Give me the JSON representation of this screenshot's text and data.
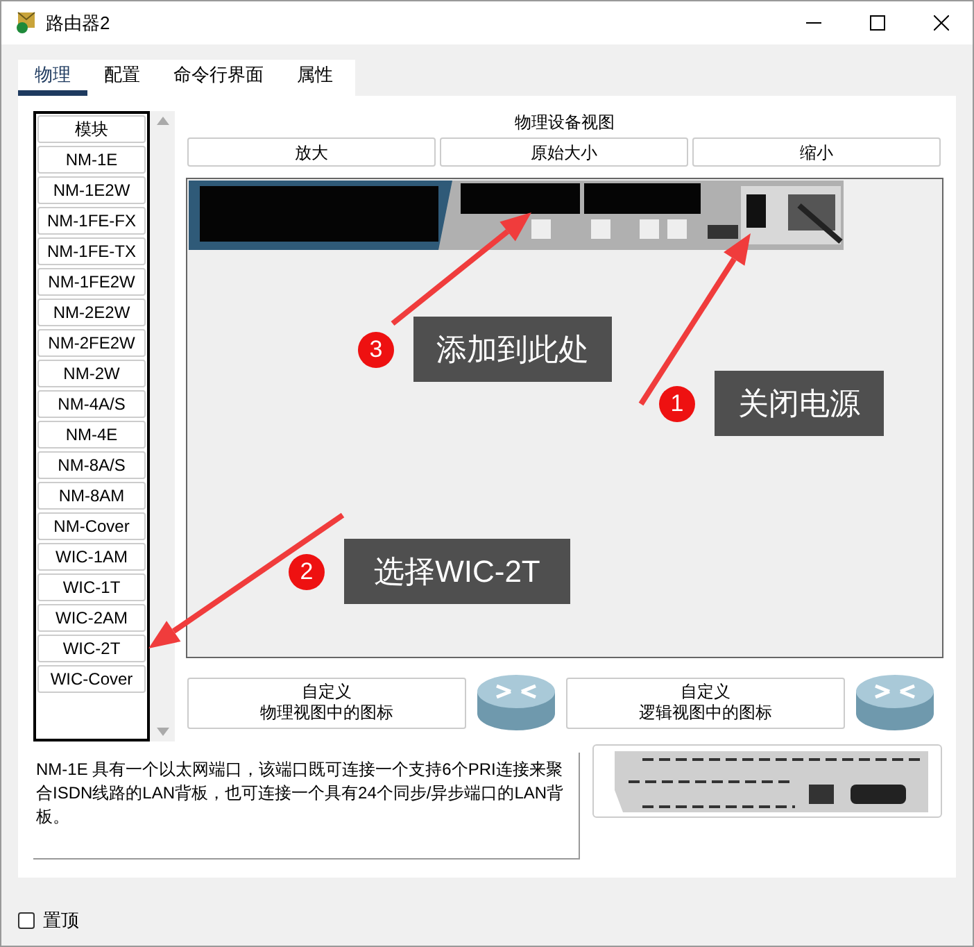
{
  "window": {
    "title": "路由器2"
  },
  "tabs": [
    {
      "label": "物理",
      "selected": true
    },
    {
      "label": "配置",
      "selected": false
    },
    {
      "label": "命令行界面",
      "selected": false
    },
    {
      "label": "属性",
      "selected": false
    }
  ],
  "modules": {
    "header": "模块",
    "items": [
      "NM-1E",
      "NM-1E2W",
      "NM-1FE-FX",
      "NM-1FE-TX",
      "NM-1FE2W",
      "NM-2E2W",
      "NM-2FE2W",
      "NM-2W",
      "NM-4A/S",
      "NM-4E",
      "NM-8A/S",
      "NM-8AM",
      "NM-Cover",
      "WIC-1AM",
      "WIC-1T",
      "WIC-2AM",
      "WIC-2T",
      "WIC-Cover"
    ]
  },
  "device_view": {
    "title": "物理设备视图",
    "zoom_buttons": [
      "放大",
      "原始大小",
      "缩小"
    ]
  },
  "callouts": [
    {
      "number": "3",
      "text": "添加到此处"
    },
    {
      "number": "1",
      "text": "关闭电源"
    },
    {
      "number": "2",
      "text": "选择WIC-2T"
    }
  ],
  "custom_buttons": [
    {
      "line1": "自定义",
      "line2": "物理视图中的图标"
    },
    {
      "line1": "自定义",
      "line2": "逻辑视图中的图标"
    }
  ],
  "description": "NM-1E 具有一个以太网端口，该端口既可连接一个支持6个PRI连接来聚合ISDN线路的LAN背板，也可连接一个具有24个同步/异步端口的LAN背板。",
  "stay_on_top": {
    "label": "置顶",
    "checked": false
  }
}
